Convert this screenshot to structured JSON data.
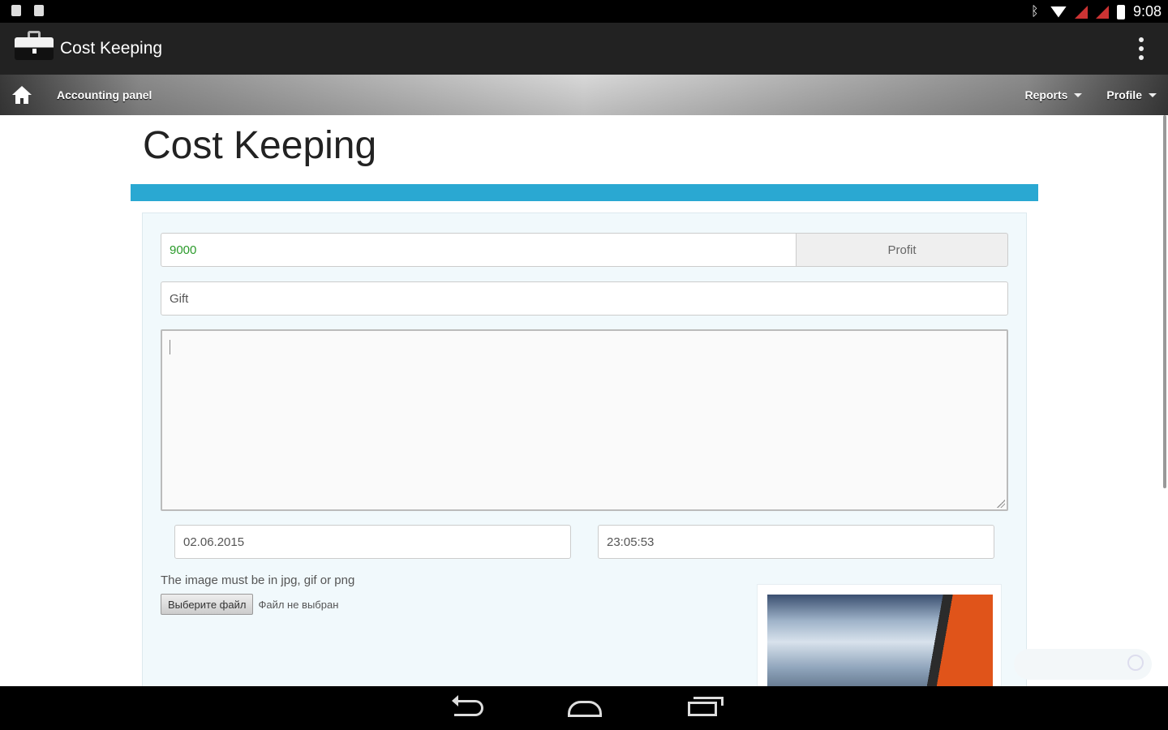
{
  "status_bar": {
    "time": "9:08"
  },
  "app_bar": {
    "title": "Cost Keeping",
    "app_icon": "briefcase-icon",
    "menu_icon": "overflow-menu-icon"
  },
  "nav": {
    "brand": "Accounting panel",
    "items": [
      {
        "label": "Reports"
      },
      {
        "label": "Profile"
      }
    ]
  },
  "page": {
    "title": "Cost Keeping",
    "accent_color": "#2aa8d2",
    "form": {
      "amount_value": "9000",
      "type_button": "Profit",
      "category_value": "Gift",
      "notes_value": "",
      "date_value": "02.06.2015",
      "time_value": "23:05:53",
      "image_hint": "The image must be in jpg, gif or png",
      "file_button": "Выберите файл",
      "file_status": "Файл не выбран"
    }
  },
  "system_nav": {
    "back": "back-icon",
    "home": "home-icon",
    "recent": "recent-apps-icon"
  }
}
